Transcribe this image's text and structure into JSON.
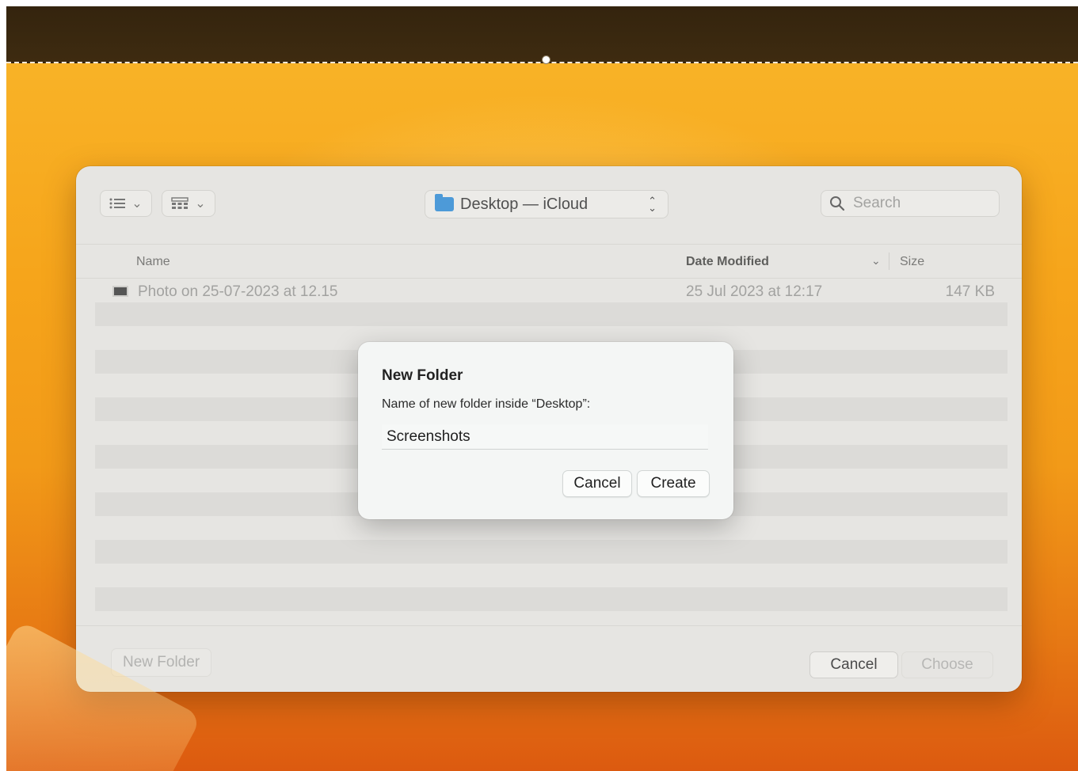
{
  "toolbar": {
    "list_view_icon": "list-icon",
    "grid_view_icon": "grid-icon",
    "chevron": "⌄",
    "location": "Desktop — iCloud",
    "search_placeholder": "Search"
  },
  "columns": {
    "name": "Name",
    "date_modified": "Date Modified",
    "size": "Size"
  },
  "files": [
    {
      "name": "Photo on 25-07-2023 at 12.15",
      "date": "25 Jul 2023 at 12:17",
      "size": "147 KB"
    }
  ],
  "footer": {
    "new_folder": "New Folder",
    "cancel": "Cancel",
    "choose": "Choose"
  },
  "dialog": {
    "title": "New Folder",
    "message": "Name of new folder inside “Desktop”:",
    "input_value": "Screenshots",
    "cancel": "Cancel",
    "create": "Create"
  }
}
